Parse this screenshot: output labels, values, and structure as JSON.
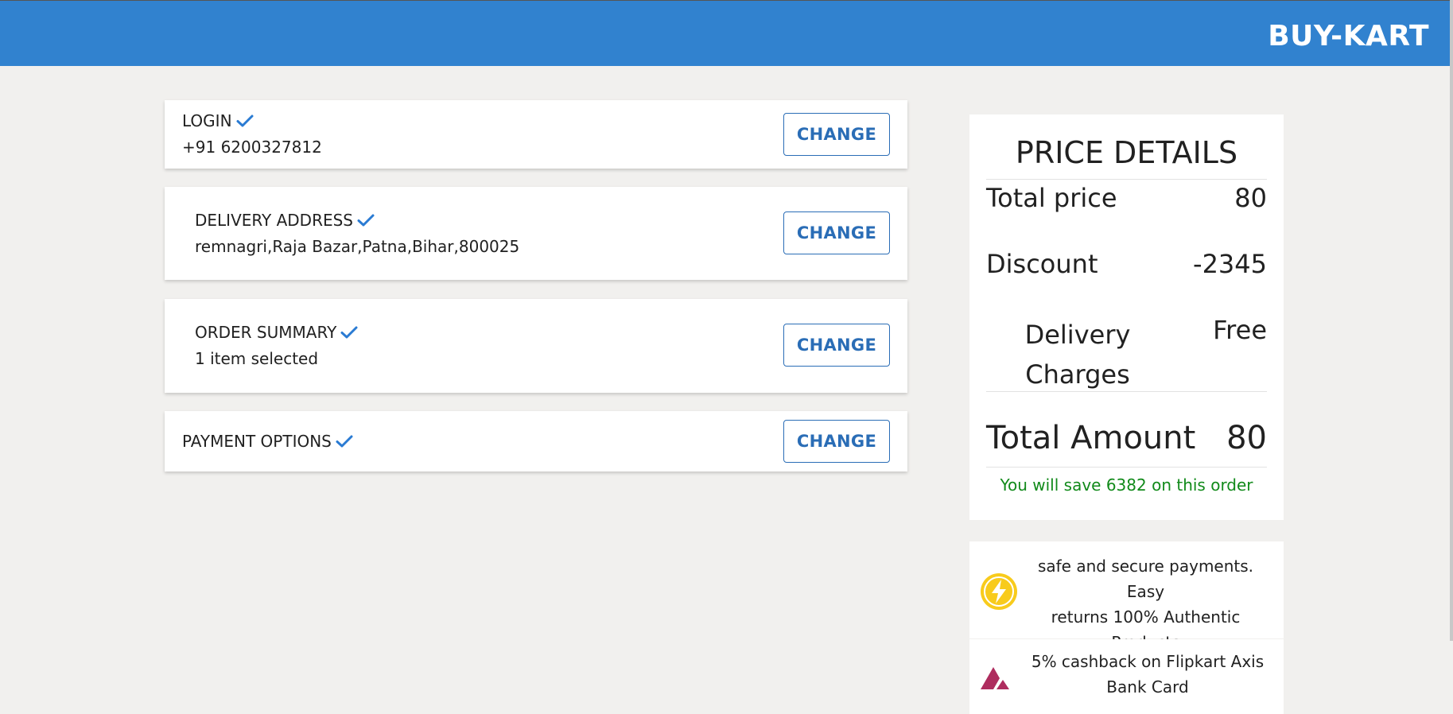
{
  "header": {
    "brand": "BUY-KART"
  },
  "steps": [
    {
      "title": "LOGIN",
      "detail": "+91 6200327812",
      "button": "CHANGE"
    },
    {
      "title": "DELIVERY ADDRESS",
      "detail": "remnagri,Raja Bazar,Patna,Bihar,800025",
      "button": "CHANGE"
    },
    {
      "title": "ORDER SUMMARY",
      "detail": "1 item selected",
      "button": "CHANGE"
    },
    {
      "title": "PAYMENT OPTIONS",
      "detail": "",
      "button": "CHANGE"
    }
  ],
  "price_details": {
    "title": "PRICE DETAILS",
    "total_price_label": "Total price",
    "total_price_value": "80",
    "discount_label": "Discount",
    "discount_value": "-2345",
    "delivery_label_line1": "Delivery",
    "delivery_label_line2": "Charges",
    "delivery_value": "Free",
    "total_amount_label": "Total Amount",
    "total_amount_value": "80",
    "savings_text": "You will save 6382 on this order"
  },
  "info": {
    "secure_line1": "safe and secure payments. Easy",
    "secure_line2": "returns 100% Authentic",
    "secure_line3": "Products",
    "cashback_line1": "5% cashback on Flipkart Axis",
    "cashback_line2": "Bank Card"
  },
  "colors": {
    "accent": "#3182cf",
    "button_text": "#2a6db6",
    "success": "#118a1a",
    "check": "#2a7bd3",
    "bolt_yellow": "#f8cb1c",
    "axis_brand": "#ae2c5e"
  },
  "icons": {
    "check": "check-icon",
    "secure": "lightning-bolt-icon",
    "cashback": "axis-bank-logo-icon"
  }
}
